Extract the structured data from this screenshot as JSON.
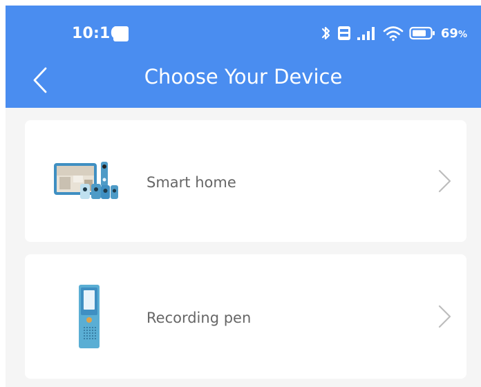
{
  "status_bar": {
    "time": "10:16",
    "battery_value": "69",
    "battery_unit": "%"
  },
  "header": {
    "title": "Choose Your Device",
    "back_icon": "chevron-left-icon"
  },
  "devices": [
    {
      "label": "Smart home",
      "icon": "smart-home-devices-image"
    },
    {
      "label": "Recording pen",
      "icon": "recording-pen-image"
    }
  ],
  "colors": {
    "header_bg": "#4a8df0",
    "page_bg": "#f5f5f5",
    "card_bg": "#ffffff",
    "label_text": "#666666",
    "chevron": "#bdbdbd"
  }
}
